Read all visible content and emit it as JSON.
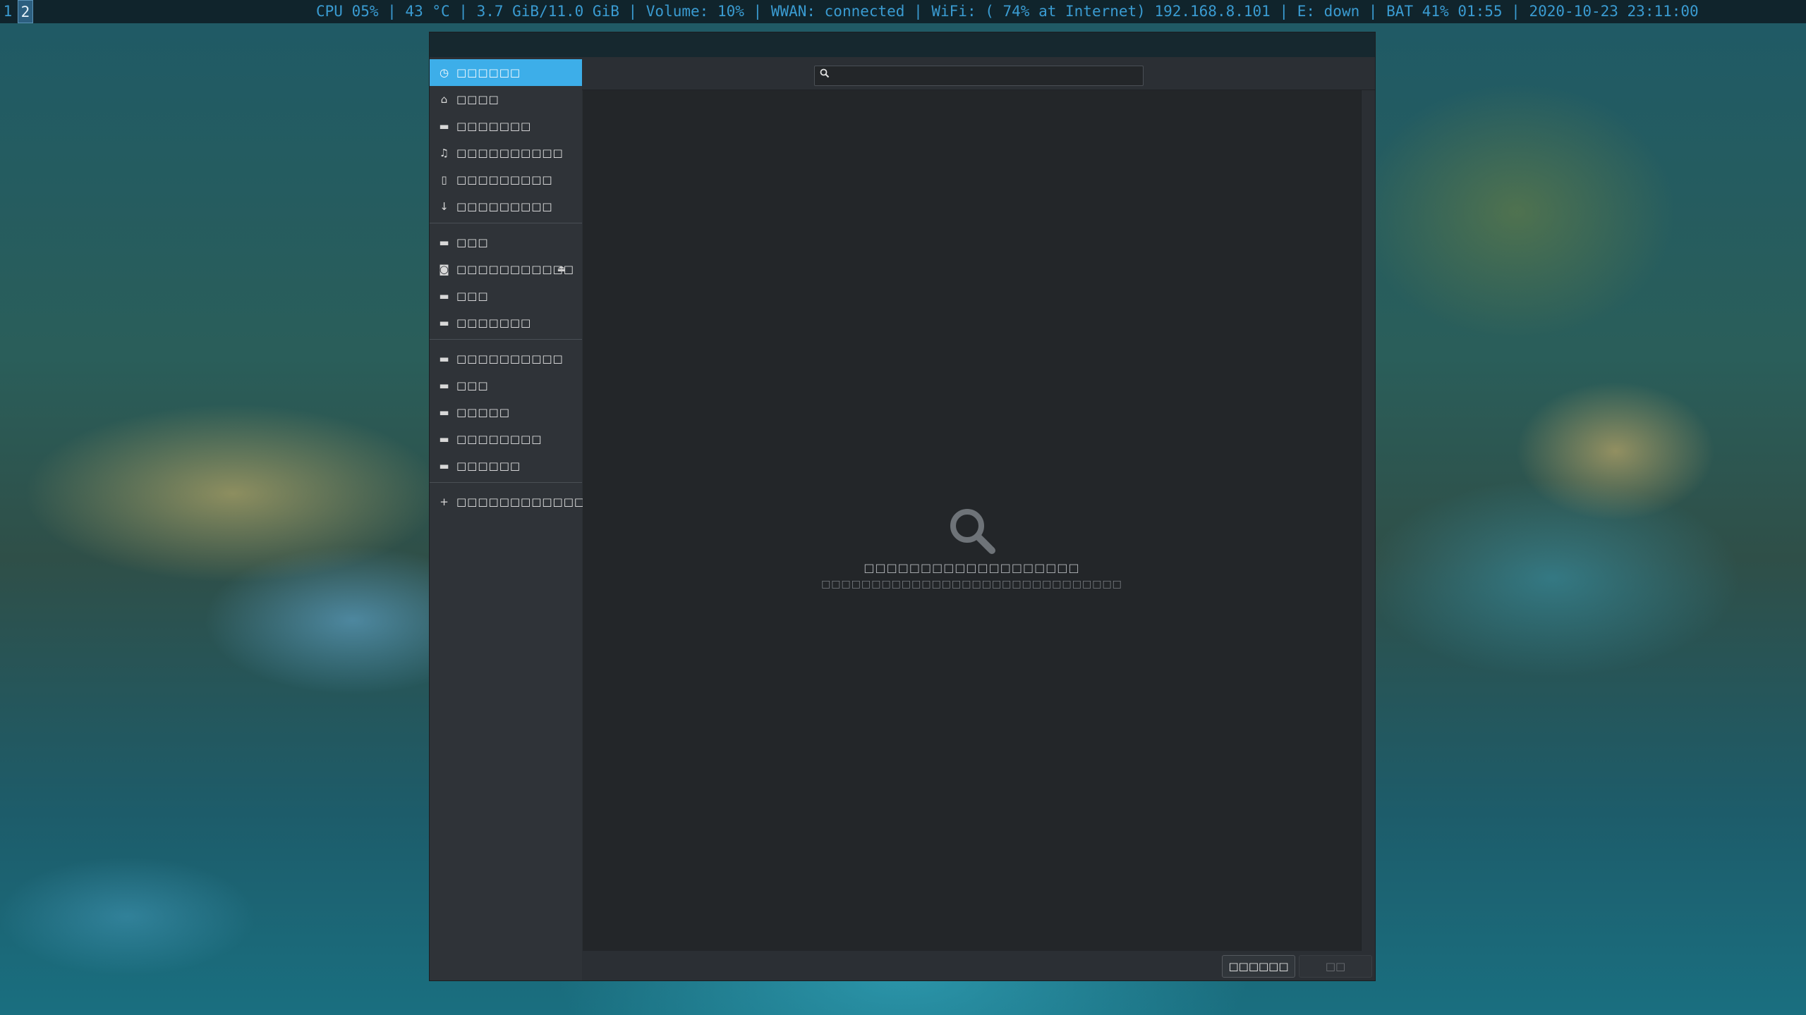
{
  "statusbar": {
    "workspaces": [
      {
        "label": "1",
        "active": false
      },
      {
        "label": "2",
        "active": true
      }
    ],
    "text": "CPU 05% | 43 °C | 3.7 GiB/11.0 GiB | Volume: 10% | WWAN:    connected | WiFi: ( 74% at Internet) 192.168.8.101 | E: down | BAT 41% 01:55 | 2020-10-23 23:11:00"
  },
  "sidebar": {
    "places": [
      {
        "label": "□□□□□□",
        "icon": "clock-icon",
        "glyph": "◷",
        "active": true
      },
      {
        "label": "□□□□",
        "icon": "home-icon",
        "glyph": "⌂"
      },
      {
        "label": "□□□□□□□",
        "icon": "folder-icon",
        "glyph": "▬"
      },
      {
        "label": "□□□□□□□□□□",
        "icon": "music-icon",
        "glyph": "♫"
      },
      {
        "label": "□□□□□□□□□",
        "icon": "document-icon",
        "glyph": "▯"
      },
      {
        "label": "□□□□□□□□□",
        "icon": "download-icon",
        "glyph": "↓"
      }
    ],
    "devices": [
      {
        "label": "□□□",
        "icon": "drive-icon",
        "glyph": "▬"
      },
      {
        "label": "□□□□□□□□□□□",
        "icon": "disc-icon",
        "glyph": "◙",
        "eject": "⏏"
      },
      {
        "label": "□□□",
        "icon": "drive-icon",
        "glyph": "▬"
      },
      {
        "label": "□□□□□□□",
        "icon": "drive-icon",
        "glyph": "▬"
      }
    ],
    "bookmarks": [
      {
        "label": "□□□□□□□□□□",
        "icon": "folder-icon",
        "glyph": "▬"
      },
      {
        "label": "□□□",
        "icon": "folder-icon",
        "glyph": "▬"
      },
      {
        "label": "□□□□□",
        "icon": "folder-icon",
        "glyph": "▬"
      },
      {
        "label": "□□□□□□□□",
        "icon": "folder-icon",
        "glyph": "▬"
      },
      {
        "label": "□□□□□□",
        "icon": "folder-icon",
        "glyph": "▬"
      }
    ],
    "other": {
      "label": "□□□□□□□□□□□□□□□",
      "icon": "plus-icon",
      "glyph": "+"
    }
  },
  "search": {
    "value": "",
    "placeholder": "",
    "icon_glyph": "🔍"
  },
  "placeholder": {
    "title": "□□□□□□□□□□□□□□□□□□□",
    "subtitle": "□□□□□□□□□□□□□□□□□□□□□□□□□□□□□□"
  },
  "footer": {
    "cancel_label": "□□□□□□",
    "open_label": "□□"
  },
  "colors": {
    "accent": "#3daee9",
    "statusbar_text": "#3a9bd1"
  }
}
